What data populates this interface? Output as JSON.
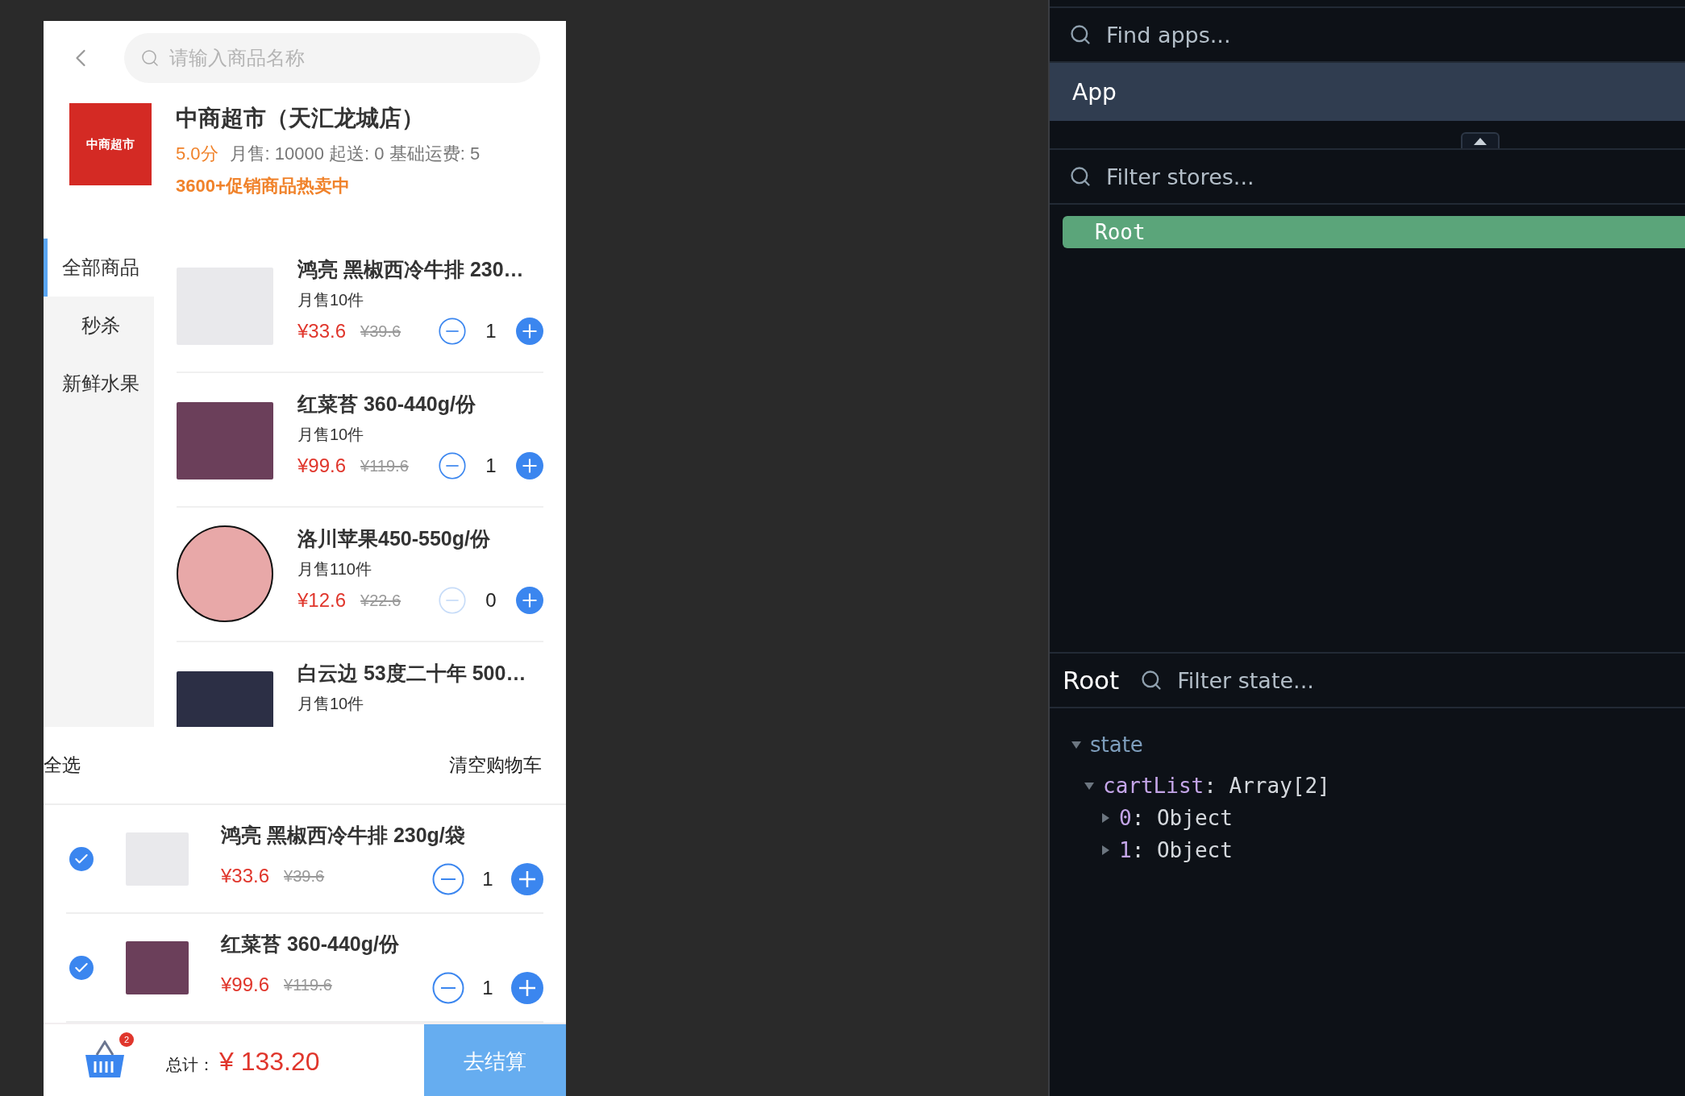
{
  "search": {
    "placeholder": "请输入商品名称"
  },
  "store": {
    "logo_text": "中商超市",
    "name": "中商超市（天汇龙城店）",
    "rating": "5.0分",
    "stats": "月售: 10000  起送: 0  基础运费: 5",
    "promo": "3600+促销商品热卖中"
  },
  "categories": [
    {
      "label": "全部商品",
      "selected": true
    },
    {
      "label": "秒杀",
      "selected": false
    },
    {
      "label": "新鲜水果",
      "selected": false
    }
  ],
  "products": [
    {
      "name": "鸿亮 黑椒西冷牛排 230…",
      "sales": "月售10件",
      "price": "¥33.6",
      "original_price": "¥39.6",
      "count": "1",
      "minus_disabled": false,
      "kind": "square"
    },
    {
      "name": "红菜苔 360-440g/份",
      "sales": "月售10件",
      "price": "¥99.6",
      "original_price": "¥119.6",
      "count": "1",
      "minus_disabled": false,
      "kind": "square"
    },
    {
      "name": "洛川苹果450-550g/份",
      "sales": "月售110件",
      "price": "¥12.6",
      "original_price": "¥22.6",
      "count": "0",
      "minus_disabled": true,
      "kind": "round"
    },
    {
      "name": "白云边 53度二十年 500…",
      "sales": "月售10件",
      "kind": "square"
    }
  ],
  "cart": {
    "select_all": "全选",
    "clear": "清空购物车",
    "items": [
      {
        "checked": true,
        "name": "鸿亮 黑椒西冷牛排 230g/袋",
        "price": "¥33.6",
        "original_price": "¥39.6",
        "count": "1"
      },
      {
        "checked": true,
        "name": "红菜苔 360-440g/份",
        "price": "¥99.6",
        "original_price": "¥119.6",
        "count": "1"
      }
    ]
  },
  "footer": {
    "badge": "2",
    "total_label": "总计：",
    "total": "¥ 133.20",
    "checkout": "去结算"
  },
  "devtools": {
    "app_search": {
      "placeholder": "Find apps..."
    },
    "apps": [
      {
        "label": "App",
        "selected": true
      }
    ],
    "store_search": {
      "placeholder": "Filter stores..."
    },
    "stores": [
      {
        "label": "Root",
        "selected": true
      }
    ],
    "state_panel": {
      "title": "Root",
      "search": {
        "placeholder": "Filter state..."
      },
      "tree": [
        {
          "key": "state",
          "expanded": true,
          "children": [
            {
              "key": "cartList",
              "value": ": Array[2]",
              "expanded": true,
              "children": [
                {
                  "key": "0",
                  "value": ": Object",
                  "expanded": false
                },
                {
                  "key": "1",
                  "value": ": Object",
                  "expanded": false
                }
              ]
            }
          ]
        }
      ]
    }
  }
}
